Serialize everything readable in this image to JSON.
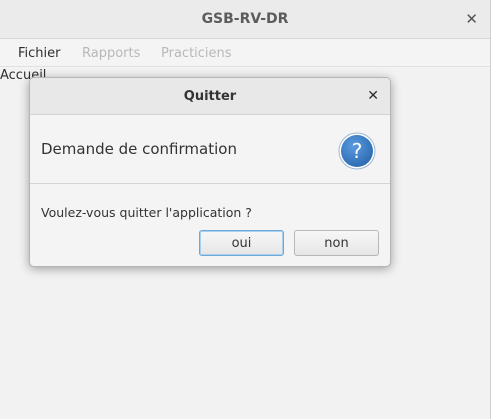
{
  "window": {
    "title": "GSB-RV-DR",
    "close_glyph": "✕"
  },
  "menubar": {
    "items": [
      {
        "label": "Fichier",
        "enabled": true
      },
      {
        "label": "Rapports",
        "enabled": false
      },
      {
        "label": "Practiciens",
        "enabled": false
      }
    ]
  },
  "main": {
    "view_label": "Accueil"
  },
  "dialog": {
    "title": "Quitter",
    "close_glyph": "✕",
    "header_text": "Demande de confirmation",
    "icon": "question-icon",
    "icon_glyph": "?",
    "message": "Voulez-vous quitter l'application ?",
    "buttons": {
      "ok_label": "oui",
      "cancel_label": "non"
    },
    "accent_color": "#3d7fc4"
  }
}
